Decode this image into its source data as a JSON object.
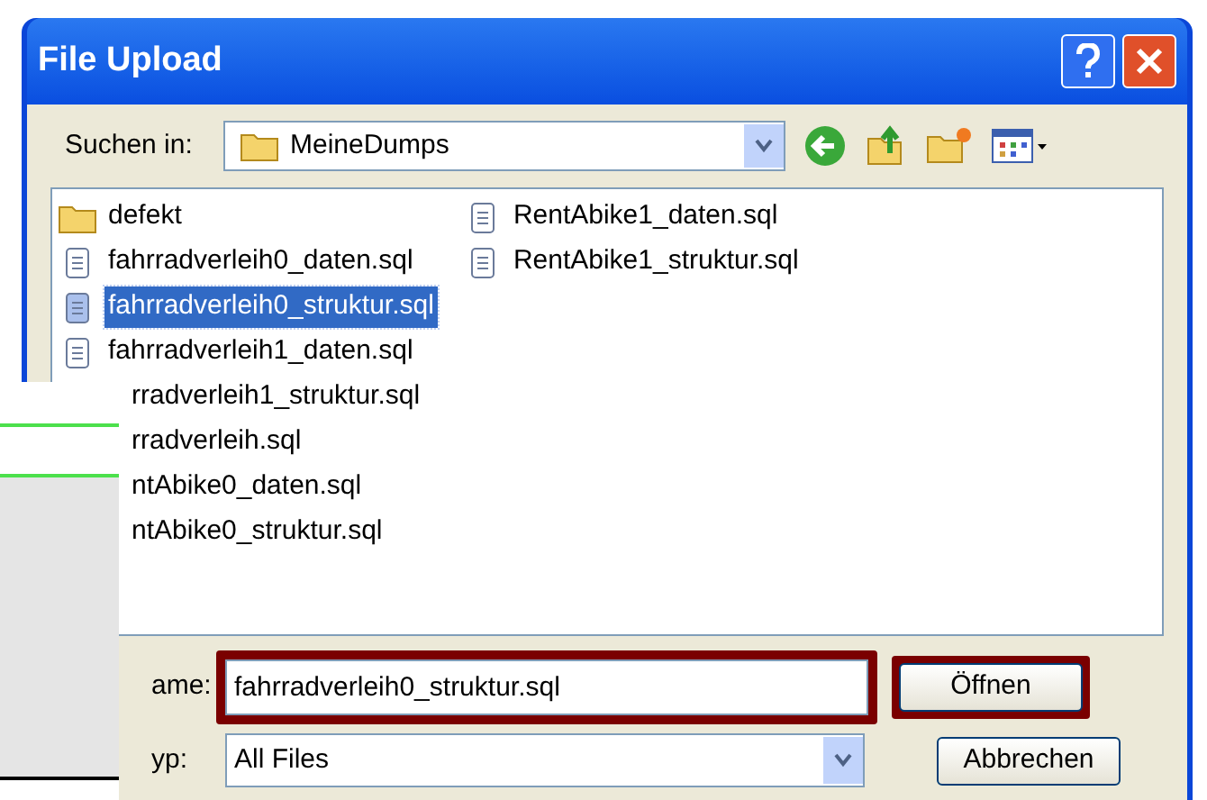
{
  "window": {
    "title": "File Upload"
  },
  "toolbar": {
    "label": "Suchen in:",
    "folder": "MeineDumps"
  },
  "files": [
    {
      "kind": "folder",
      "name": "defekt",
      "selected": false
    },
    {
      "kind": "file",
      "name": "fahrradverleih0_daten.sql",
      "selected": false
    },
    {
      "kind": "file",
      "name": "fahrradverleih0_struktur.sql",
      "selected": true
    },
    {
      "kind": "file",
      "name": "fahrradverleih1_daten.sql",
      "selected": false
    },
    {
      "kind": "hidden-icon",
      "name": "rradverleih1_struktur.sql",
      "selected": false
    },
    {
      "kind": "hidden-icon",
      "name": "rradverleih.sql",
      "selected": false
    },
    {
      "kind": "hidden-icon",
      "name": "ntAbike0_daten.sql",
      "selected": false
    },
    {
      "kind": "hidden-icon",
      "name": "ntAbike0_struktur.sql",
      "selected": false
    },
    {
      "kind": "file",
      "name": "RentAbike1_daten.sql",
      "selected": false
    },
    {
      "kind": "file",
      "name": "RentAbike1_struktur.sql",
      "selected": false
    }
  ],
  "filename": {
    "label": "ame:",
    "value": "fahrradverleih0_struktur.sql",
    "highlighted": true
  },
  "filetype": {
    "label": "yp:",
    "value": "All Files"
  },
  "buttons": [
    {
      "label": "Öffnen",
      "highlighted": true
    },
    {
      "label": "Abbrechen",
      "highlighted": false
    }
  ]
}
